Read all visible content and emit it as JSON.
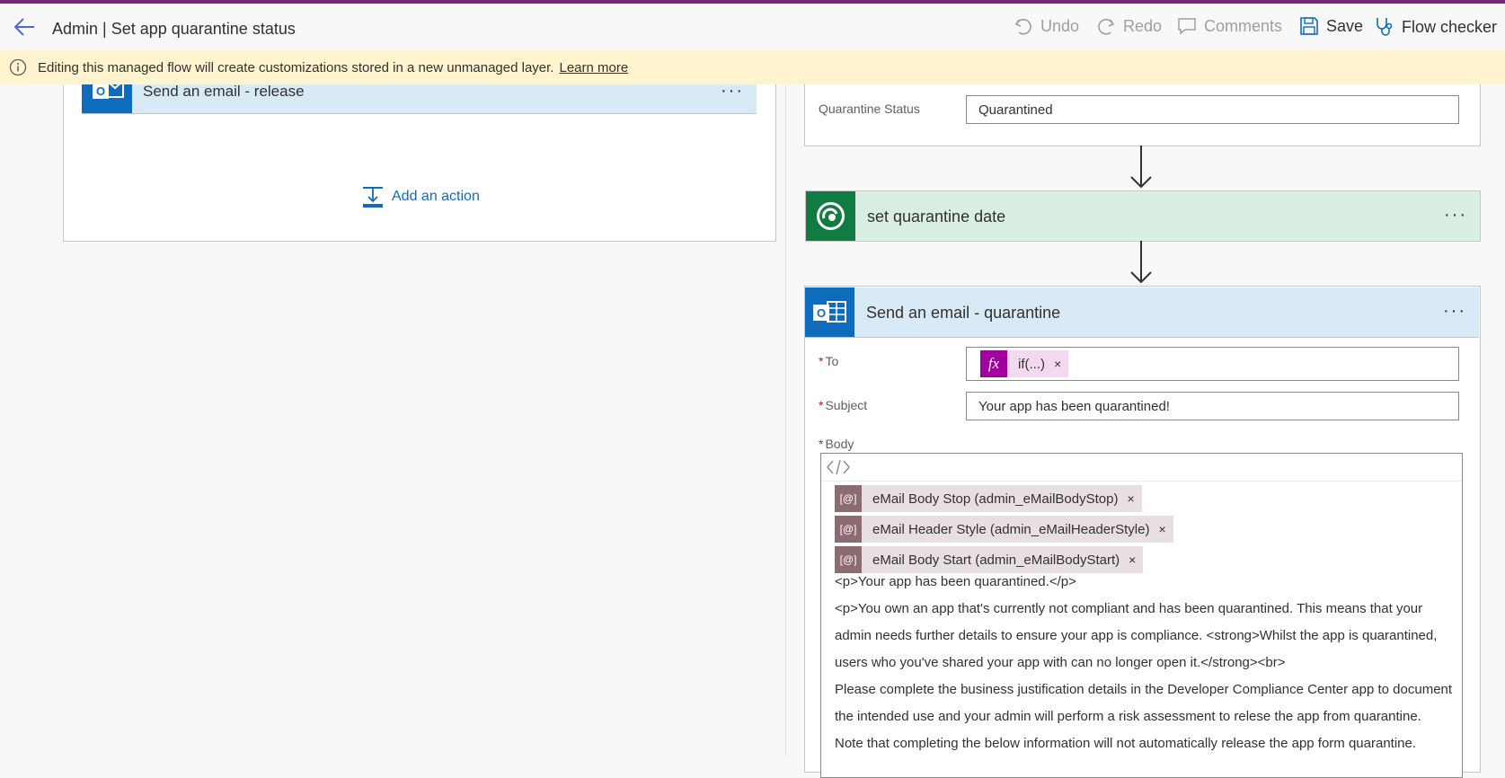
{
  "header": {
    "title": "Admin | Set app quarantine status",
    "undo": "Undo",
    "redo": "Redo",
    "comments": "Comments",
    "save": "Save",
    "flow_checker": "Flow checker"
  },
  "banner": {
    "text": "Editing this managed flow will create customizations stored in a new unmanaged layer.",
    "link": "Learn more"
  },
  "left_branch": {
    "card_title": "Send an email - release",
    "add_action": "Add an action"
  },
  "right_branch": {
    "quarantine_status_label": "Quarantine Status",
    "quarantine_status_value": "Quarantined",
    "step_title": "set quarantine date",
    "email_card_title": "Send an email - quarantine",
    "to_label": "To",
    "to_token": "if(...)",
    "subject_label": "Subject",
    "subject_value": "Your app has been quarantined!",
    "body_label": "Body",
    "tokens": [
      "eMail Body Stop (admin_eMailBodyStop)",
      "eMail Header Style (admin_eMailHeaderStyle)",
      "eMail Body Start (admin_eMailBodyStart)"
    ],
    "body_lines": [
      "<p>Your app has been quarantined.</p>",
      "<p>You own an app that's currently not compliant and has been quarantined. This means that your",
      "admin needs further details to ensure your app is compliance. <strong>Whilst the app is quarantined,",
      "users who you've shared your app with can no longer open it.</strong><br>",
      "Please complete the business justification details in the Developer Compliance Center app to document",
      "the intended use and your admin will perform a risk assessment to relese the app from quarantine.",
      "Note that completing the below information will not automatically release the app form quarantine."
    ]
  },
  "colors": {
    "accent": "#742774",
    "banner_bg": "#fff4ce",
    "outlook_blue": "#0f6cbd",
    "dataverse_green": "#107c41",
    "expression_magenta": "#a0009e",
    "variable_token": "#8c6b72"
  }
}
